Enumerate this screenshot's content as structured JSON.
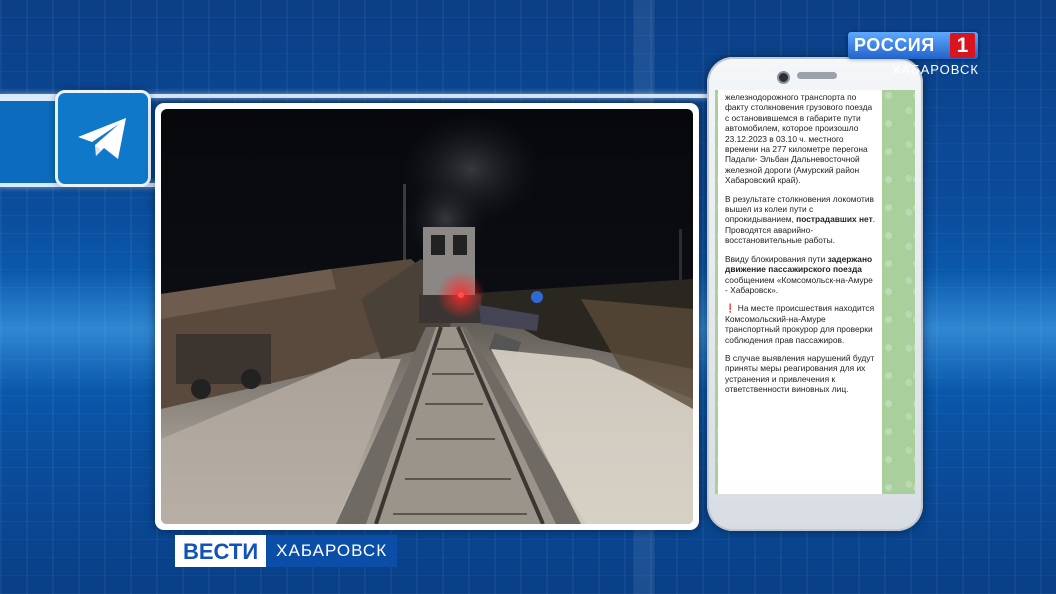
{
  "channel": {
    "logo_text": "РОССИЯ",
    "logo_number": "1",
    "region": "ХАБАРОВСК"
  },
  "program": {
    "name": "ВЕСТИ",
    "region": "ХАБАРОВСК"
  },
  "source_icon": "telegram-icon",
  "photo_subject": "train-derailment-night",
  "phone_message": {
    "p1": "железнодорожного транспорта по факту столкновения грузового поезда с остановившемся в габарите пути автомобилем, которое произошло 23.12.2023 в 03.10 ч. местного времени на 277 километре перегона Падали- Эльбан Дальневосточной железной дороги (Амурский район Хабаровский край).",
    "p2_a": "В результате столкновения локомотив вышел из колеи пути с опрокидыванием,",
    "p2_b": "пострадавших нет",
    "p2_c": ". Проводятся аварийно-восстановительные работы.",
    "p3_a": "Ввиду блокирования пути",
    "p3_b": "задержано движение пассажирского поезда",
    "p3_c": "сообщением «Комсомольск-на-Амуре - Хабаровск».",
    "p4_mark": "❗",
    "p4": "На месте происшествия находится Комсомольский-на-Амуре транспортный прокурор для проверки соблюдения прав пассажиров.",
    "p5": "В случае выявления нарушений будут приняты меры реагирования для их устранения и привлечения к ответственности виновных лиц."
  },
  "colors": {
    "background": "#0b4c9c",
    "logo_red": "#d9141c",
    "vesti_blue": "#1153b6",
    "telegram_blue": "#0f78c8"
  }
}
